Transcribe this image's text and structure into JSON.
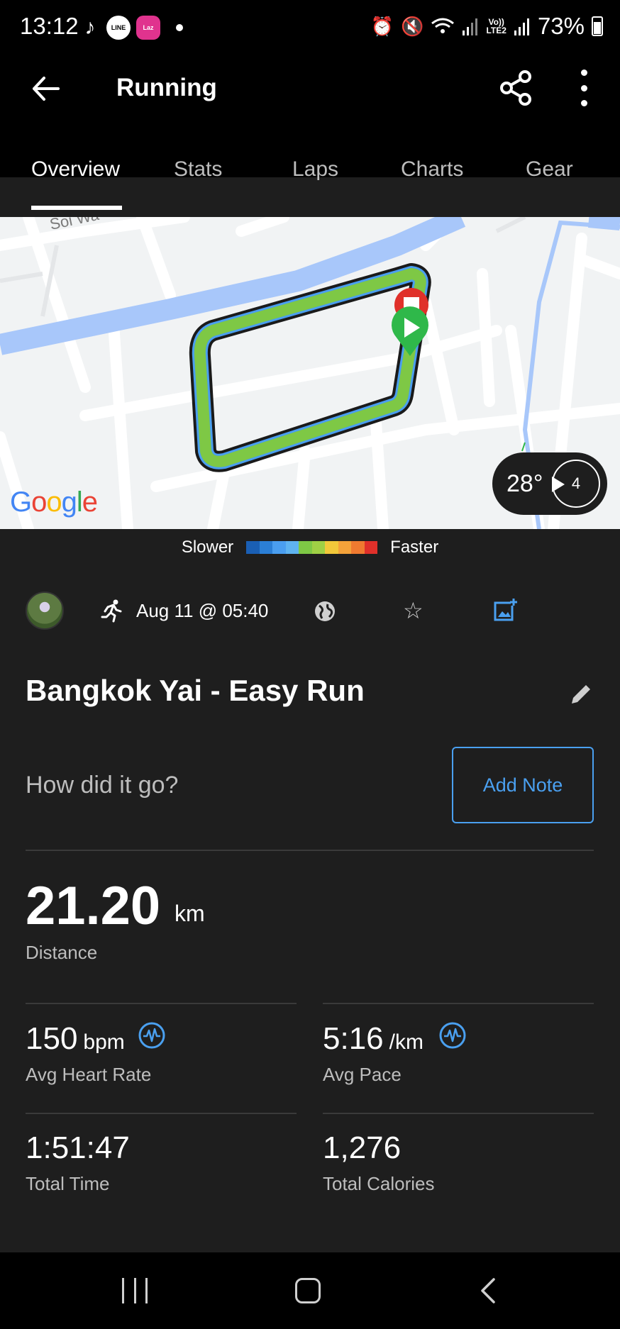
{
  "status_bar": {
    "time": "13:12",
    "battery": "73%",
    "network_label_top": "Vo))",
    "network_label_bottom": "LTE2",
    "app_icons": [
      "tiktok-icon",
      "line-icon",
      "lazada-icon"
    ]
  },
  "header": {
    "title": "Running"
  },
  "tabs": [
    {
      "label": "Overview",
      "active": true
    },
    {
      "label": "Stats",
      "active": false
    },
    {
      "label": "Laps",
      "active": false
    },
    {
      "label": "Charts",
      "active": false
    },
    {
      "label": "Gear",
      "active": false
    }
  ],
  "map": {
    "street_label": "Soi Wa",
    "attribution": "Google",
    "weather": {
      "temperature": "28°",
      "wind_speed": "4"
    }
  },
  "legend": {
    "slower_label": "Slower",
    "faster_label": "Faster",
    "colors": [
      "#1a5fb4",
      "#2b7fd6",
      "#4a9ef0",
      "#5fb3f0",
      "#7ec845",
      "#9fd045",
      "#f2c83a",
      "#f4a23a",
      "#f07a30",
      "#e0302a"
    ]
  },
  "activity": {
    "date": "Aug 11 @ 05:40",
    "title": "Bangkok Yai - Easy Run",
    "note_prompt": "How did it go?",
    "add_note_label": "Add Note"
  },
  "stats": {
    "distance": {
      "value": "21.20",
      "unit": "km",
      "label": "Distance"
    },
    "heart_rate": {
      "value": "150",
      "unit": "bpm",
      "label": "Avg Heart Rate"
    },
    "pace": {
      "value": "5:16",
      "unit": "/km",
      "label": "Avg Pace"
    },
    "total_time": {
      "value": "1:51:47",
      "label": "Total Time"
    },
    "calories": {
      "value": "1,276",
      "label": "Total Calories"
    }
  },
  "colors": {
    "accent": "#4aa0f0",
    "route_green": "#7ec845",
    "start_marker": "#2fb84a",
    "stop_marker": "#e0302a"
  }
}
